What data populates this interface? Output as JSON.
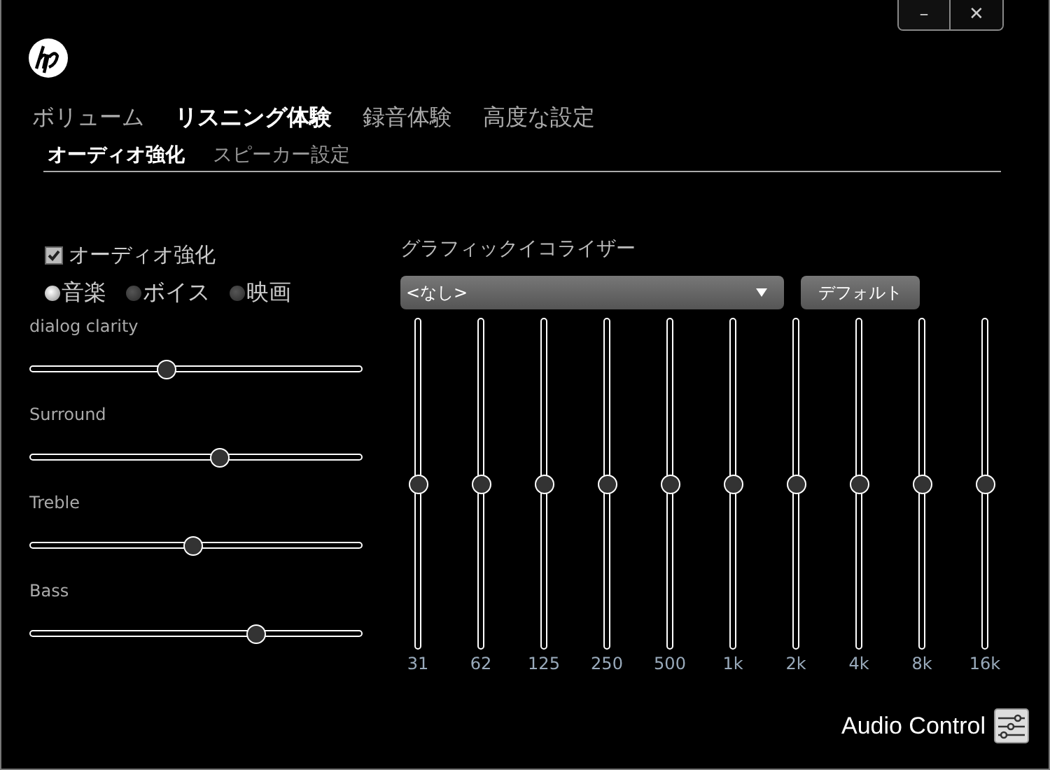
{
  "window_controls": [
    {
      "kind": "minimize",
      "label": "–"
    },
    {
      "kind": "close",
      "label": "✕"
    }
  ],
  "tabs": [
    {
      "label": "ボリューム",
      "selected": false
    },
    {
      "label": "リスニング体験",
      "selected": true
    },
    {
      "label": "録音体験",
      "selected": false
    },
    {
      "label": "高度な設定",
      "selected": false
    }
  ],
  "subtabs": [
    {
      "label": "オーディオ強化",
      "selected": true
    },
    {
      "label": "スピーカー設定",
      "selected": false
    }
  ],
  "enhancement": {
    "label": "オーディオ強化",
    "checked": true
  },
  "modes": [
    {
      "label": "音楽",
      "selected": true
    },
    {
      "label": "ボイス",
      "selected": false
    },
    {
      "label": "映画",
      "selected": false
    }
  ],
  "sliders": [
    {
      "label": "dialog clarity",
      "level": 0.41
    },
    {
      "label": "Surround",
      "level": 0.57
    },
    {
      "label": "Treble",
      "level": 0.49
    },
    {
      "label": "Bass",
      "level": 0.68
    }
  ],
  "equalizer": {
    "title": "グラフィックイコライザー",
    "preset": "<なし>",
    "default_button": "デフォルト",
    "bands": [
      {
        "label": "31",
        "level": 0.5
      },
      {
        "label": "62",
        "level": 0.5
      },
      {
        "label": "125",
        "level": 0.5
      },
      {
        "label": "250",
        "level": 0.5
      },
      {
        "label": "500",
        "level": 0.5
      },
      {
        "label": "1k",
        "level": 0.5
      },
      {
        "label": "2k",
        "level": 0.5
      },
      {
        "label": "4k",
        "level": 0.5
      },
      {
        "label": "8k",
        "level": 0.5
      },
      {
        "label": "16k",
        "level": 0.5
      }
    ]
  },
  "footer": {
    "label": "Audio Control"
  }
}
